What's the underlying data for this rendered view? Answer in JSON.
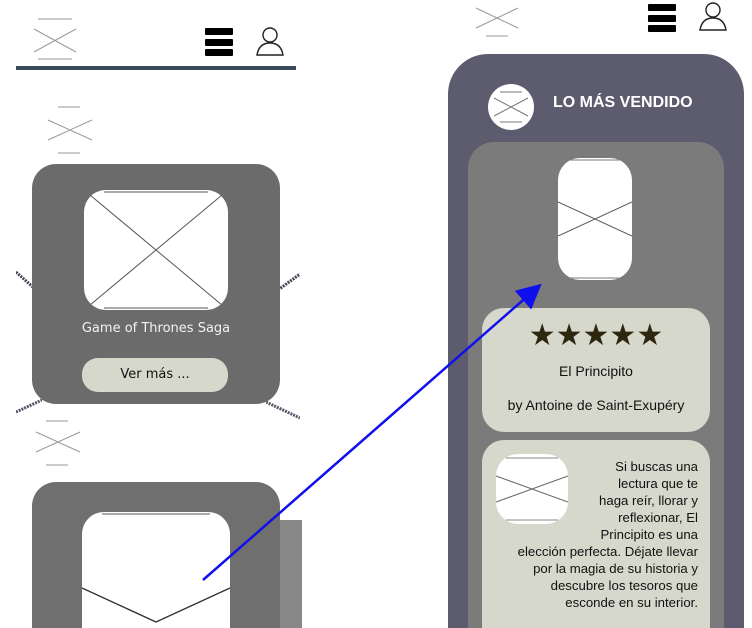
{
  "colors": {
    "left_card": "#6b6b6b",
    "right_panel": "#5d5b6e",
    "inner_card": "#7b7b7b",
    "light_card": "#d6d8cc",
    "arrow": "#1010ee",
    "stars": "#2e2710"
  },
  "icons": {
    "menu": "hamburger-menu-icon",
    "user": "user-profile-icon",
    "placeholder": "image-placeholder-icon"
  },
  "left_screen": {
    "featured_card": {
      "title": "Game of Thrones Saga",
      "button_label": "Ver más ..."
    }
  },
  "right_screen": {
    "section_title": "LO MÁS VENDIDO",
    "book": {
      "stars": "★★★★★",
      "rating": 5,
      "title": "El Principito",
      "author": "by Antoine de Saint-Exupéry",
      "description_lines": [
        "Si buscas una",
        "lectura que te",
        "haga reír, llorar y",
        "reflexionar, El",
        "Principito es una",
        "elección perfecta. Déjate llevar",
        "por la magia de su historia y",
        "descubre los tesoros que",
        "esconde en su interior."
      ]
    }
  }
}
